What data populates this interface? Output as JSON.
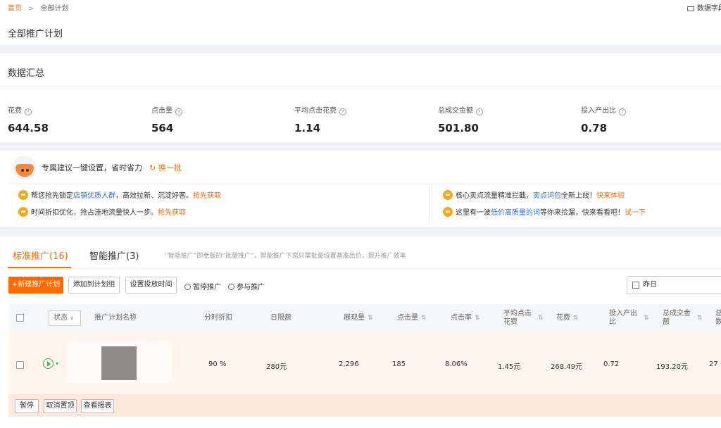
{
  "breadcrumb": {
    "home": "首页",
    "separator": ">",
    "current": "全部计划"
  },
  "top_right": {
    "label": "数据字段"
  },
  "page_title": "全部推广计划",
  "summary": {
    "title": "数据汇总",
    "metrics": [
      {
        "label": "花费",
        "value": "644.58"
      },
      {
        "label": "点击量",
        "value": "564"
      },
      {
        "label": "平均点击花费",
        "value": "1.14"
      },
      {
        "label": "总成交金额",
        "value": "501.80"
      },
      {
        "label": "投入产出比",
        "value": "0.78"
      }
    ]
  },
  "suggestion": {
    "title": "专属建议一键设置，省时省力",
    "refresh": "换一批",
    "tips": [
      {
        "pre": "帮您抢先锁定",
        "highlight": "店铺优质人群",
        "post": "，高效拉新、沉淀好客。",
        "action": "抢先获取"
      },
      {
        "pre": "时间折扣优化，抢占洼地流量快人一步。",
        "highlight": "",
        "post": "",
        "action": "抢先获取"
      },
      {
        "pre": "核心卖点流量精准拦截，",
        "highlight": "卖点词包",
        "post": "全新上线！",
        "action": "快来体验"
      },
      {
        "pre": "这里有一波",
        "highlight": "低价高质量的词",
        "post": "等你来捡漏，快来看看吧！",
        "action": "试一下"
      }
    ]
  },
  "tabs": [
    {
      "label": "标准推广(16)"
    },
    {
      "label": "智能推广(3)"
    }
  ],
  "tab_note": "“智能推广”即老版的“批量推广”，智能推广下您只需批量设置基准出价，提升推广效率",
  "toolbar": {
    "new_plan": "+新建推广计划",
    "add_group": "添加到计划组",
    "set_time": "设置投放时间",
    "pause": "暂停推广",
    "join": "参与推广",
    "date": "昨日"
  },
  "table": {
    "status_select": "状态",
    "columns": {
      "name": "推广计划名称",
      "discount": "分时折扣",
      "budget": "日限额",
      "impressions": "展现量",
      "clicks": "点击量",
      "ctr": "点击率",
      "cpc_line1": "平均点击",
      "cpc_line2": "花费",
      "cost": "花费",
      "roi_line1": "投入产出",
      "roi_line2": "比",
      "gmv_line1": "总成交金",
      "gmv_line2": "额",
      "more_line1": "总",
      "more_line2": "数"
    },
    "sort_icon": "⇅",
    "rows": [
      {
        "discount": "90 %",
        "budget": "280元",
        "impressions": "2,296",
        "clicks": "185",
        "ctr": "8.06%",
        "cpc": "1.45元",
        "cost": "268.49元",
        "roi": "0.72",
        "gmv": "193.20元",
        "more": "27"
      }
    ],
    "row_actions": [
      "暂停",
      "取消置顶",
      "查看报表"
    ]
  }
}
